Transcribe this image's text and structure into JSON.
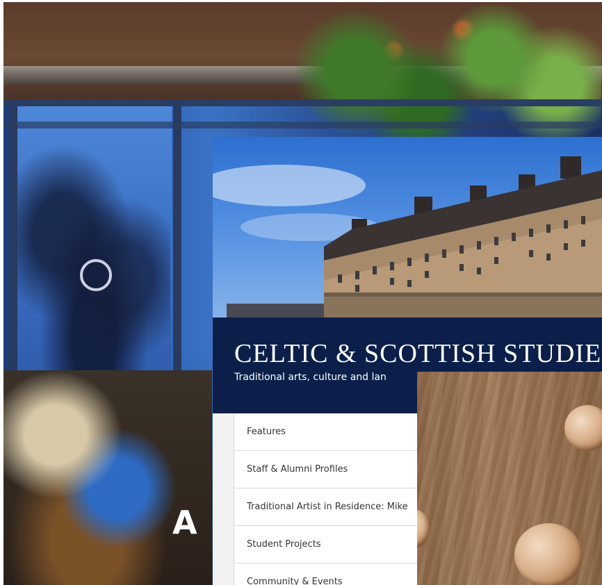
{
  "background_page": {
    "headline_fragment": "A V"
  },
  "celtic_page": {
    "title": "CELTIC & SCOTTISH STUDIES",
    "subtitle": "Traditional arts, culture and lan",
    "nav": [
      {
        "label": "Features"
      },
      {
        "label": "Staff & Alumni Profiles"
      },
      {
        "label": "Traditional Artist in Residence: Mike"
      },
      {
        "label": "Student Projects"
      },
      {
        "label": "Community & Events"
      }
    ],
    "colors": {
      "banner": "#0b1f4a",
      "nav_background": "#f2f2f2",
      "nav_text": "#333333"
    }
  },
  "front_panel": {
    "material": "wood-panel-with-round-metal-inlays"
  }
}
